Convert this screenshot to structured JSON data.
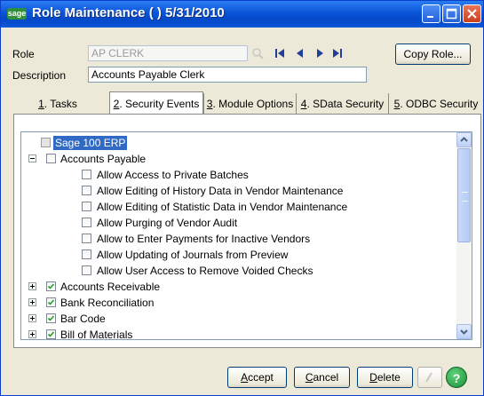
{
  "window": {
    "title": "Role Maintenance (  ) 5/31/2010",
    "logo_text": "sage",
    "controls": [
      "minimize-icon",
      "maximize-icon",
      "close-icon"
    ]
  },
  "form": {
    "role_label": "Role",
    "role_value": "AP CLERK",
    "description_label": "Description",
    "description_value": "Accounts Payable Clerk",
    "copy_role_button": "Copy Role...",
    "nav_icons": [
      "lookup-icon",
      "first-record-icon",
      "previous-record-icon",
      "next-record-icon",
      "last-record-icon"
    ]
  },
  "tabs": [
    {
      "num": "1",
      "label": ". Tasks",
      "active": false
    },
    {
      "num": "2",
      "label": ". Security Events",
      "active": true
    },
    {
      "num": "3",
      "label": ". Module Options",
      "active": false
    },
    {
      "num": "4",
      "label": ". SData Security",
      "active": false
    },
    {
      "num": "5",
      "label": ". ODBC Security",
      "active": false
    }
  ],
  "tree": {
    "root": "Sage 100 ERP",
    "accounts_payable": {
      "label": "Accounts Payable",
      "checked": false,
      "expanded": true,
      "children": [
        "Allow Access to Private Batches",
        "Allow Editing of History Data in Vendor Maintenance",
        "Allow Editing of Statistic Data in Vendor Maintenance",
        "Allow Purging of Vendor Audit",
        "Allow to Enter Payments for Inactive Vendors",
        "Allow Updating of Journals from Preview",
        "Allow User Access to Remove Voided Checks"
      ]
    },
    "modules": [
      {
        "label": "Accounts Receivable",
        "checked": true,
        "expanded": false
      },
      {
        "label": "Bank Reconciliation",
        "checked": true,
        "expanded": false
      },
      {
        "label": "Bar Code",
        "checked": true,
        "expanded": false
      },
      {
        "label": "Bill of Materials",
        "checked": true,
        "expanded": false
      }
    ]
  },
  "footer": {
    "accept_button": "Accept",
    "cancel_button": "Cancel",
    "delete_button": "Delete",
    "help_button": "?"
  }
}
